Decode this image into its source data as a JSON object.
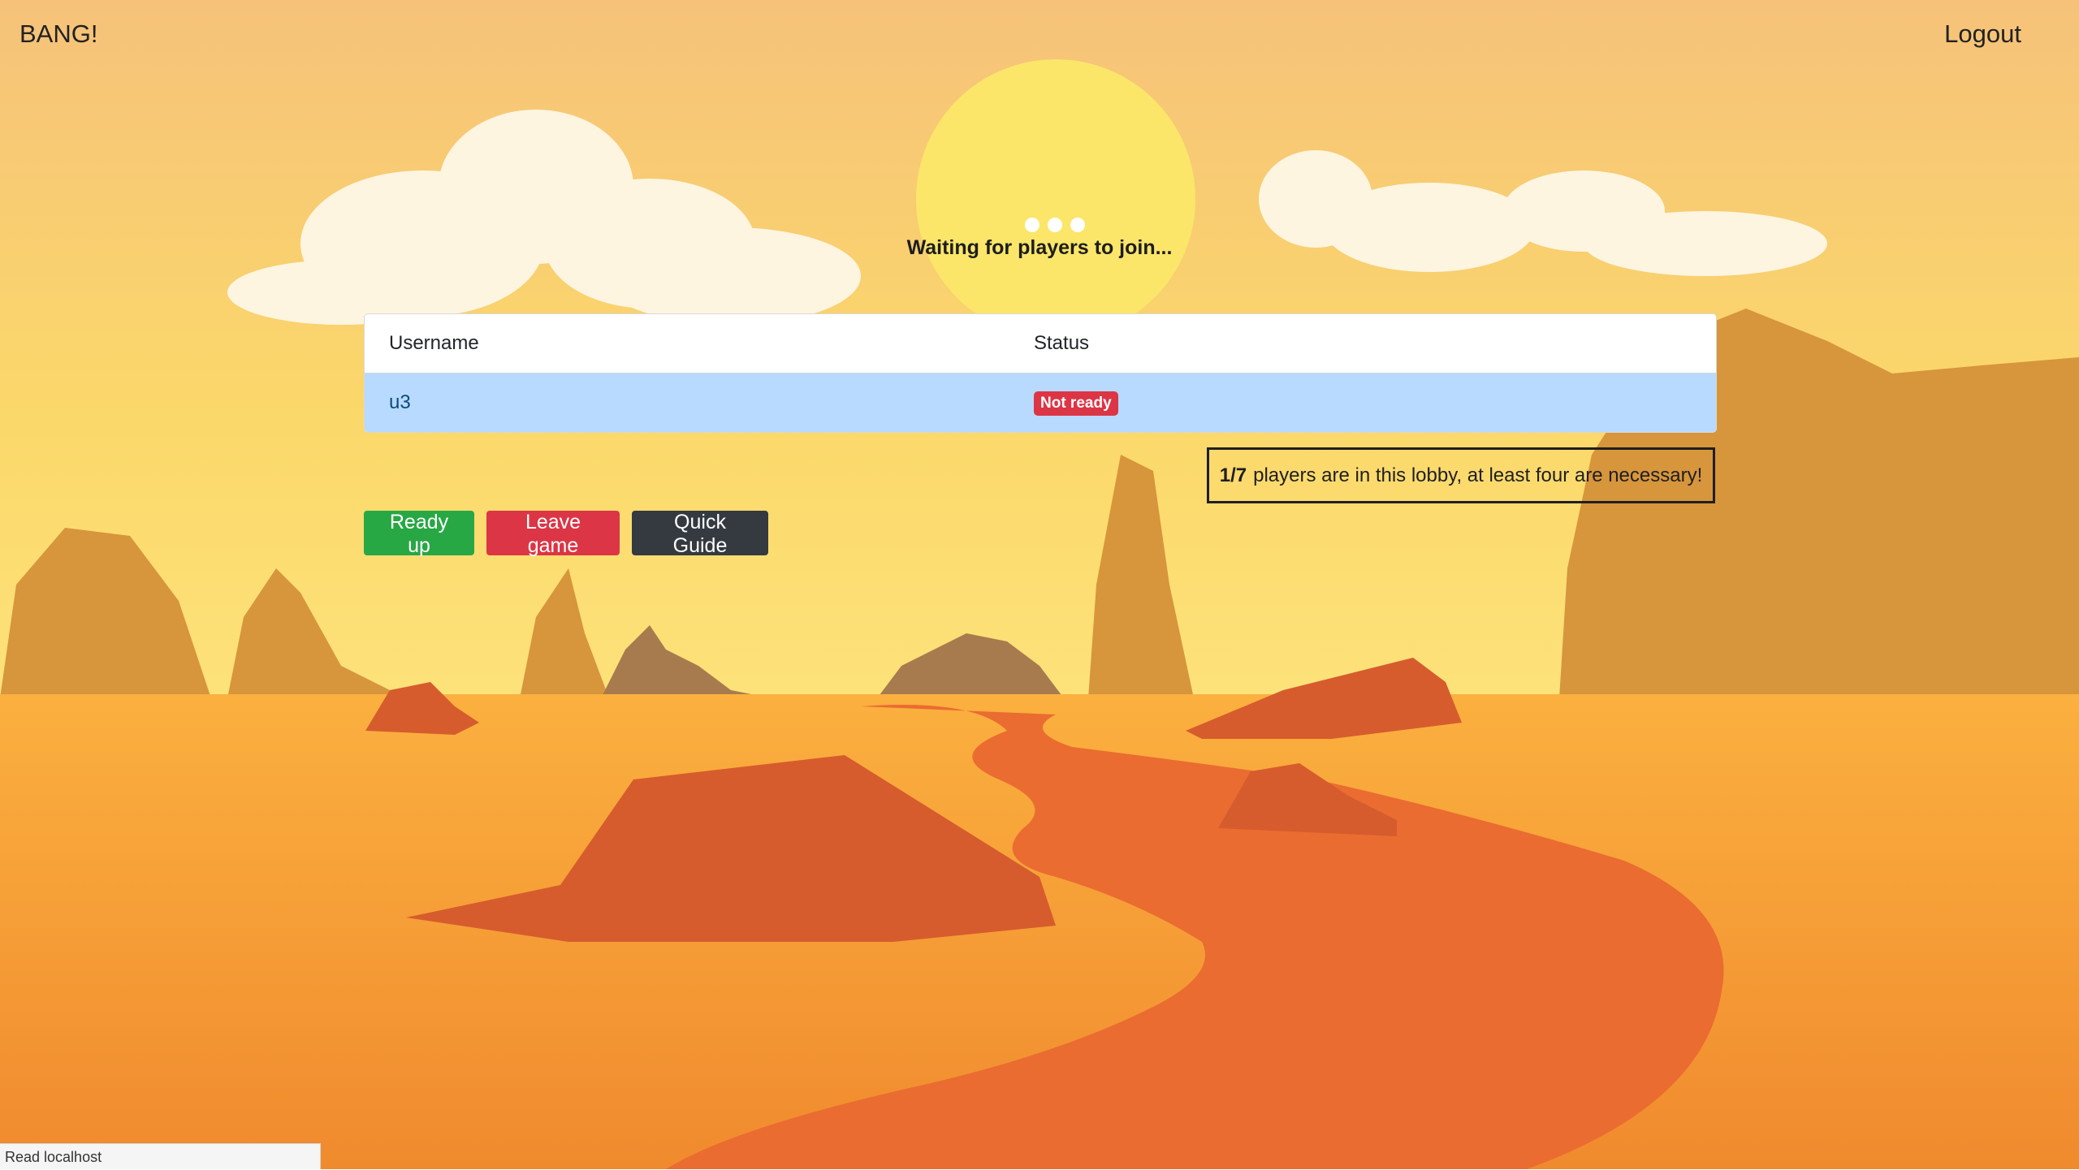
{
  "header": {
    "brand": "BANG!",
    "logout_label": "Logout"
  },
  "lobby": {
    "waiting_text": "Waiting for players to join...",
    "table": {
      "columns": [
        "Username",
        "Status"
      ],
      "rows": [
        {
          "username": "u3",
          "status": "Not ready"
        }
      ]
    },
    "notice": {
      "count": "1/7",
      "text": "players are in this lobby, at least four are necessary!"
    },
    "buttons": {
      "ready": "Ready up",
      "leave": "Leave game",
      "guide": "Quick Guide"
    }
  },
  "statusbar": {
    "text": "Read localhost"
  },
  "colors": {
    "ready": "#28a745",
    "leave": "#dc3545",
    "guide": "#343a40",
    "badge": "#dc3545",
    "row_highlight": "#b8daff"
  },
  "icons": [
    "loading-dots-icon"
  ]
}
